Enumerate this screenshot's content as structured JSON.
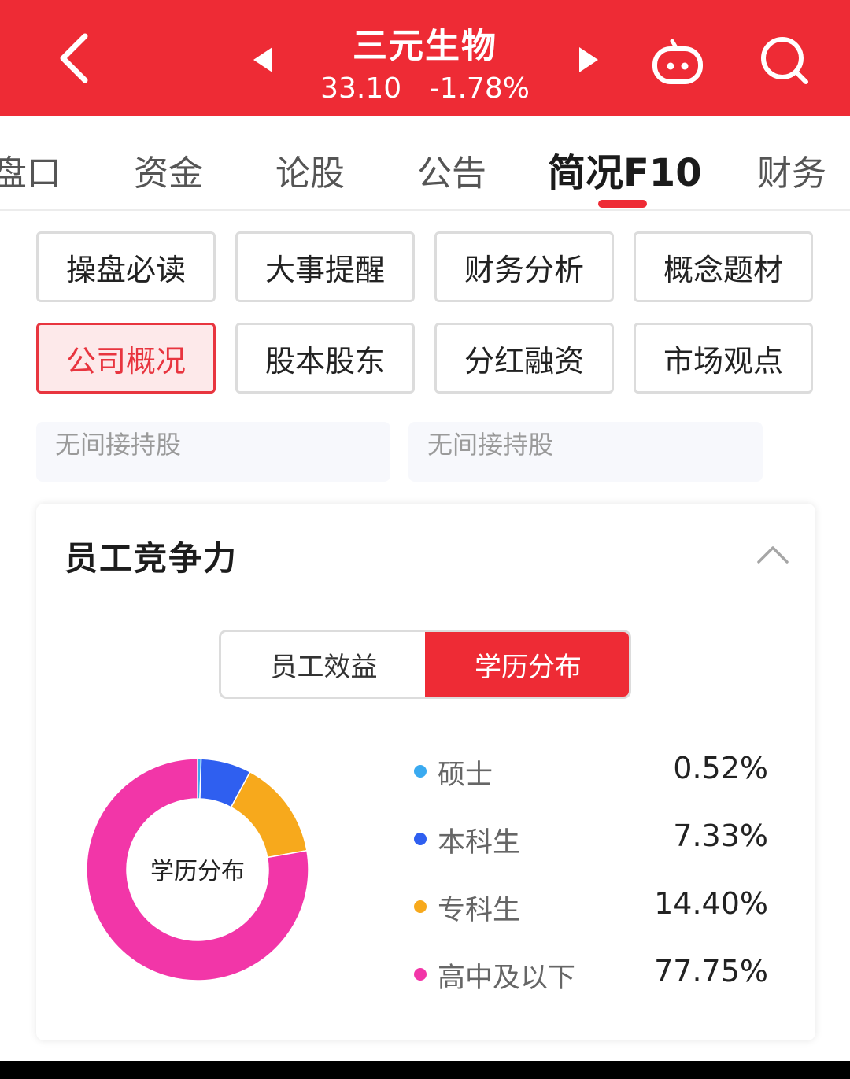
{
  "header": {
    "stock_name": "三元生物",
    "price": "33.10",
    "change": "-1.78%",
    "bg_color": "#ee2b35",
    "icons": [
      "back-icon",
      "prev-triangle-icon",
      "next-triangle-icon",
      "robot-icon",
      "search-icon"
    ]
  },
  "tabs": [
    {
      "label": "盘口"
    },
    {
      "label": "资金"
    },
    {
      "label": "论股"
    },
    {
      "label": "公告"
    },
    {
      "label": "简况F10",
      "active": true
    },
    {
      "label": "财务"
    }
  ],
  "menu": {
    "row1": [
      "操盘必读",
      "大事提醒",
      "财务分析",
      "概念题材"
    ],
    "row2": [
      "公司概况",
      "股本股东",
      "分红融资",
      "市场观点"
    ],
    "active": "公司概况"
  },
  "holdings": {
    "left": "无间接持股",
    "right": "无间接持股"
  },
  "card": {
    "title": "员工竞争力",
    "segments": {
      "left": "员工效益",
      "right": "学历分布",
      "active": "学历分布"
    }
  },
  "chart_data": {
    "type": "pie",
    "center_label": "学历分布",
    "donut": true,
    "slices": [
      {
        "label": "硕士",
        "value": 0.52,
        "display": "0.52%",
        "color": "#3aaaf0"
      },
      {
        "label": "本科生",
        "value": 7.33,
        "display": "7.33%",
        "color": "#2f5ff0"
      },
      {
        "label": "专科生",
        "value": 14.4,
        "display": "14.40%",
        "color": "#f7a91c"
      },
      {
        "label": "高中及以下",
        "value": 77.75,
        "display": "77.75%",
        "color": "#f236a8"
      }
    ]
  }
}
